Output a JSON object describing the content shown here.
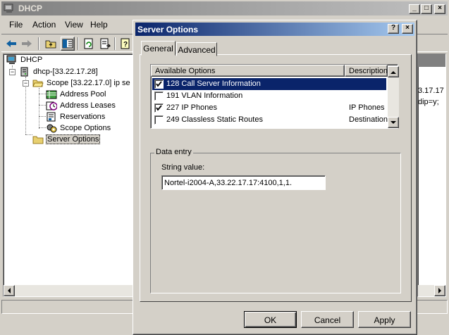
{
  "main_window": {
    "title": "DHCP",
    "menu": [
      "File",
      "Action",
      "View",
      "Help"
    ],
    "tree": {
      "root": "DHCP",
      "server": "dhcp-[33.22.17.28]",
      "scope": "Scope [33.22.17.0] ip se",
      "scope_children": [
        "Address Pool",
        "Address Leases",
        "Reservations",
        "Scope Options"
      ],
      "server_options": "Server Options"
    },
    "right_pane_values": [
      "3.17.17",
      "dip=y;"
    ]
  },
  "dialog": {
    "title": "Server Options",
    "help_button": "?",
    "close_button": "×",
    "tabs": [
      "General",
      "Advanced"
    ],
    "active_tab": "General",
    "list_headers": [
      "Available Options",
      "Description"
    ],
    "options": [
      {
        "name": "128 Call Server Information",
        "description": "",
        "checked": true,
        "selected": true
      },
      {
        "name": "191 VLAN Information",
        "description": "",
        "checked": false,
        "selected": false
      },
      {
        "name": "227 IP Phones",
        "description": "IP Phones",
        "checked": true,
        "selected": false
      },
      {
        "name": "249 Classless Static Routes",
        "description": "Destination,",
        "checked": false,
        "selected": false
      }
    ],
    "data_entry": {
      "legend": "Data entry",
      "string_label": "String value:",
      "string_value": "Nortel-i2004-A,33.22.17.17:4100,1,1."
    },
    "buttons": {
      "ok": "OK",
      "cancel": "Cancel",
      "apply": "Apply"
    }
  },
  "colors": {
    "active_title": "#0a246a",
    "active_title_end": "#a6caf0",
    "inactive_title": "#808080",
    "face": "#d4d0c8"
  }
}
